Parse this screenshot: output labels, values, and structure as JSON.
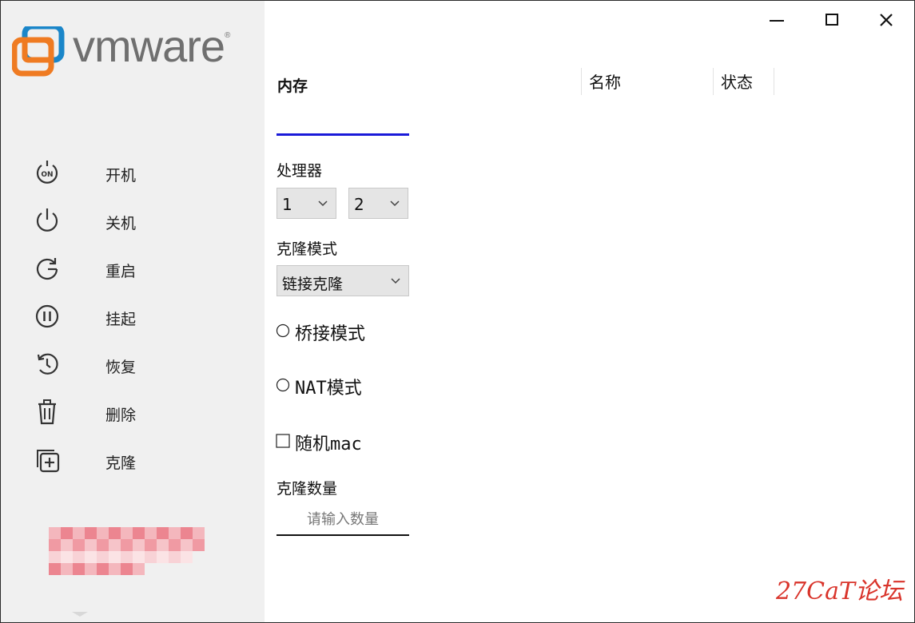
{
  "brand": {
    "logo_text": "vmware",
    "trademark": "®",
    "colors": {
      "logo_orange": "#ef7b22",
      "logo_blue": "#1a86c9",
      "text_gray": "#6f6f6f"
    }
  },
  "window_controls": {
    "minimize": "minimize-icon",
    "maximize": "maximize-icon",
    "close": "close-icon"
  },
  "sidebar": {
    "items": [
      {
        "label": "开机",
        "icon": "power-on-icon"
      },
      {
        "label": "关机",
        "icon": "power-off-icon"
      },
      {
        "label": "重启",
        "icon": "restart-icon"
      },
      {
        "label": "挂起",
        "icon": "pause-icon"
      },
      {
        "label": "恢复",
        "icon": "resume-icon"
      },
      {
        "label": "删除",
        "icon": "trash-icon"
      },
      {
        "label": "克隆",
        "icon": "clone-icon"
      }
    ]
  },
  "main": {
    "tab_memory": "内存",
    "table_columns": [
      "名称",
      "状态"
    ],
    "processor": {
      "label": "处理器",
      "select1": "1",
      "select2": "2"
    },
    "clone_mode": {
      "label": "克隆模式",
      "value": "链接克隆"
    },
    "network": {
      "bridge": "桥接模式",
      "nat": "NAT模式"
    },
    "random_mac": "随机mac",
    "clone_count": {
      "label": "克隆数量",
      "placeholder": "请输入数量"
    }
  },
  "watermark": "27CaT论坛",
  "accent_color": "#1a1ad9"
}
